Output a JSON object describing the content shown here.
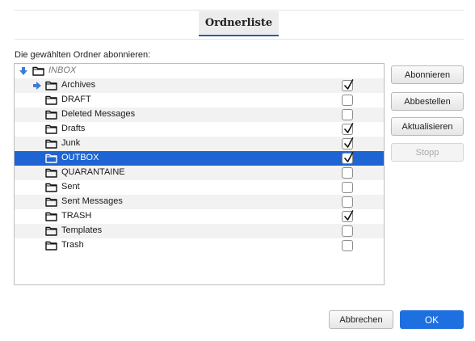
{
  "tabs": {
    "active_label": "Ordnerliste"
  },
  "list": {
    "label": "Die gewählten Ordner abonnieren:",
    "root": {
      "name": "INBOX",
      "icon": "folder-icon"
    },
    "folders": [
      {
        "name": "Archives",
        "checked": true
      },
      {
        "name": "DRAFT",
        "checked": false
      },
      {
        "name": "Deleted Messages",
        "checked": false
      },
      {
        "name": "Drafts",
        "checked": true
      },
      {
        "name": "Junk",
        "checked": true
      },
      {
        "name": "OUTBOX",
        "checked": true,
        "selected": true
      },
      {
        "name": "QUARANTAINE",
        "checked": false
      },
      {
        "name": "Sent",
        "checked": false
      },
      {
        "name": "Sent Messages",
        "checked": false
      },
      {
        "name": "TRASH",
        "checked": true
      },
      {
        "name": "Templates",
        "checked": false
      },
      {
        "name": "Trash",
        "checked": false
      }
    ]
  },
  "actions": {
    "subscribe": "Abonnieren",
    "unsubscribe": "Abbestellen",
    "refresh": "Aktualisieren",
    "stop": "Stopp"
  },
  "footer": {
    "cancel": "Abbrechen",
    "ok": "OK"
  },
  "colors": {
    "selection": "#1e64d2",
    "accent": "#1e6fe0",
    "arrow": "#3d7fd6"
  }
}
